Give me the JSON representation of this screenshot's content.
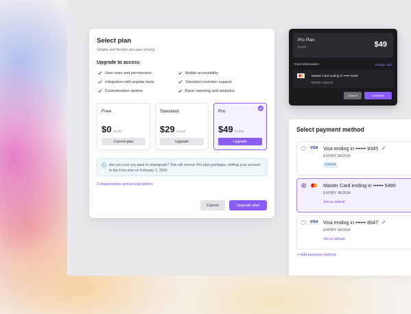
{
  "colors": {
    "accent": "#8a5cf6",
    "dark_card": "#1b1b1e",
    "info_bg": "#f1f8fb"
  },
  "modal": {
    "title": "Select plan",
    "subtitle": "Simple and flexible per-user pricing.",
    "upgrade_heading": "Upgrade to access",
    "features": [
      "User roles and permissions",
      "Mobile accessibility",
      "Integration with popular tools",
      "Standard customer support",
      "Customization options",
      "Basic reporting and analytics"
    ],
    "plans": [
      {
        "name": "Free",
        "price": "$0",
        "per": "/month",
        "button": "Current plan",
        "selected": false
      },
      {
        "name": "Standard",
        "price": "$29",
        "per": "/month",
        "button": "Upgrade",
        "selected": false
      },
      {
        "name": "Pro",
        "price": "$49",
        "per": "/month",
        "button": "Upgrade",
        "selected": true
      }
    ],
    "info_text": "Are you sure you want to downgrade? This will remove Pro plan privileges, shifting your account to the Free plan on February 1, 2024.",
    "compare_link": "Compare plans and pricing options",
    "cancel_label": "Cancel",
    "upgrade_label": "Upgrade plan"
  },
  "dark_card": {
    "plan_name": "Pro Plan",
    "per": "/month",
    "price": "$49",
    "info_label": "Card Information",
    "change_link": "Change card",
    "card_text": "Master Card ending in •••••• 5490",
    "expiry": "EXPIRY  06/2024",
    "cancel_label": "Cancel",
    "continue_label": "Continue"
  },
  "payment": {
    "title": "Select payment method",
    "methods": [
      {
        "brand": "VISA",
        "name": "Visa ending in •••••• 9345",
        "expiry": "EXPIRY  06/2024",
        "tag": "Default",
        "selected": false
      },
      {
        "brand": "mastercard",
        "name": "Master Card ending in •••••• 5490",
        "expiry": "EXPIRY  06/2024",
        "tag": "Set as default",
        "selected": true
      },
      {
        "brand": "VISA",
        "name": "Visa ending in •••••• 8647",
        "expiry": "EXPIRY  06/2024",
        "tag": "Set as default",
        "selected": false
      }
    ],
    "add_label": "+ Add payment method"
  }
}
